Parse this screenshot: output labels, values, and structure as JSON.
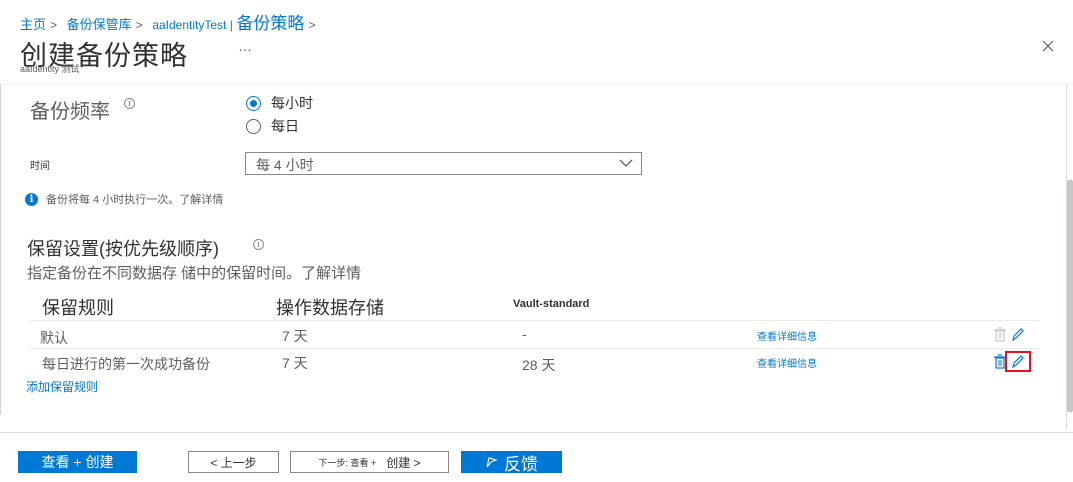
{
  "breadcrumb": {
    "items": [
      "主页",
      "备份保管库",
      "aaIdentityTest |"
    ],
    "current": "备份策略"
  },
  "page": {
    "title": "创建备份策略",
    "subtitle": "aaIdentity 测试",
    "more": "…"
  },
  "frequency": {
    "label": "备份频率",
    "options": [
      "每小时",
      "每日"
    ],
    "selected": "每小时"
  },
  "time": {
    "label": "时间",
    "value": "每 4 小时"
  },
  "notice": {
    "text": "备份将每 4 小时执行一次。了解详情"
  },
  "retention": {
    "title": "保留设置(按优先级顺序)",
    "description": "指定备份在不同数据存 储中的保留时间。了解详情",
    "columns": [
      "保留规则",
      "操作数据存储",
      "Vault-standard"
    ],
    "rows": [
      {
        "rule": "默认",
        "operational": "7 天",
        "vault": "-",
        "details": "查看详细信息"
      },
      {
        "rule": "每日进行的第一次成功备份",
        "operational": "7 天",
        "vault": "28 天",
        "details": "查看详细信息"
      }
    ],
    "add_rule": "添加保留规则"
  },
  "footer": {
    "review": "查看 + 创建",
    "prev": "< 上一步",
    "next_prefix": "下一步: 查看 +",
    "next_suffix": "创建 >",
    "feedback": "反馈"
  },
  "colors": {
    "accent": "#0078d4",
    "highlight_box": "#e81123"
  }
}
